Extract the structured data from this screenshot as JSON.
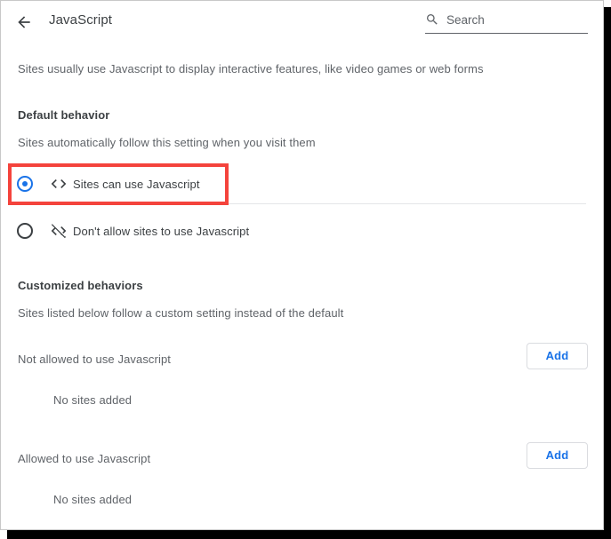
{
  "window": {
    "frame_border_color": "#c8c8c8",
    "shadow_color": "#000000"
  },
  "header": {
    "back_icon": "arrow-left-icon",
    "title": "JavaScript",
    "search": {
      "icon": "search-icon",
      "placeholder": "Search",
      "value": ""
    }
  },
  "main": {
    "intro": "Sites usually use Javascript to display interactive features, like video games or web forms",
    "default_behavior": {
      "heading": "Default behavior",
      "subtext": "Sites automatically follow this setting when you visit them",
      "options": [
        {
          "id": "allow",
          "icon": "code-icon",
          "label": "Sites can use Javascript",
          "selected": true
        },
        {
          "id": "disallow",
          "icon": "code-slashed-icon",
          "label": "Don't allow sites to use Javascript",
          "selected": false
        }
      ]
    },
    "customized_behaviors": {
      "heading": "Customized behaviors",
      "subtext": "Sites listed below follow a custom setting instead of the default",
      "lists": [
        {
          "title": "Not allowed to use Javascript",
          "add_label": "Add",
          "empty_text": "No sites added"
        },
        {
          "title": "Allowed to use Javascript",
          "add_label": "Add",
          "empty_text": "No sites added"
        }
      ]
    }
  },
  "annotation": {
    "highlight_color": "#f4433c",
    "target": "Sites can use Javascript"
  },
  "colors": {
    "accent_blue": "#1a73e8",
    "text_primary": "#3c4043",
    "text_secondary": "#5f6368",
    "divider": "#e4e6e8",
    "button_border": "#dadce0"
  }
}
